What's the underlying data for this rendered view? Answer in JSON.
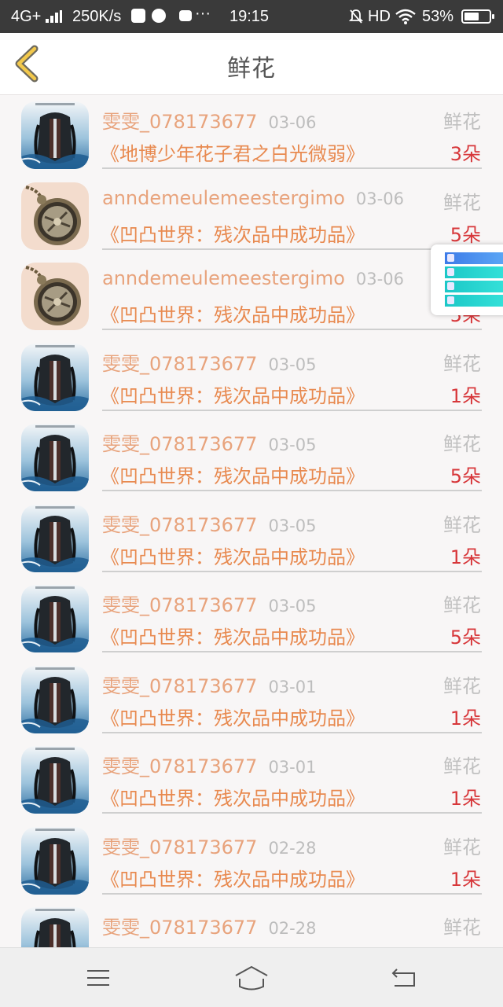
{
  "status_bar": {
    "network": "4G+",
    "speed": "250K/s",
    "time": "19:15",
    "hd": "HD",
    "battery": "53%",
    "battery_level": 0.53
  },
  "header": {
    "title": "鲜花",
    "back_icon": "chevron-left-icon"
  },
  "list": {
    "items": [
      {
        "user": "雯雯_078173677",
        "date": "03-06",
        "type": "鲜花",
        "book": "《地博少年花子君之白光微弱》",
        "count": "3朵",
        "avatar": "backpack"
      },
      {
        "user": "anndemeulemeestergimo",
        "date": "03-06",
        "type": "鲜花",
        "book": "《凹凸世界：残次品中成功品》",
        "count": "5朵",
        "avatar": "pocket-watch"
      },
      {
        "user": "anndemeulemeestergimo",
        "date": "03-06",
        "type": "鲜花",
        "book": "《凹凸世界：残次品中成功品》",
        "count": "5朵",
        "avatar": "pocket-watch"
      },
      {
        "user": "雯雯_078173677",
        "date": "03-05",
        "type": "鲜花",
        "book": "《凹凸世界：残次品中成功品》",
        "count": "1朵",
        "avatar": "backpack"
      },
      {
        "user": "雯雯_078173677",
        "date": "03-05",
        "type": "鲜花",
        "book": "《凹凸世界：残次品中成功品》",
        "count": "5朵",
        "avatar": "backpack"
      },
      {
        "user": "雯雯_078173677",
        "date": "03-05",
        "type": "鲜花",
        "book": "《凹凸世界：残次品中成功品》",
        "count": "1朵",
        "avatar": "backpack"
      },
      {
        "user": "雯雯_078173677",
        "date": "03-05",
        "type": "鲜花",
        "book": "《凹凸世界：残次品中成功品》",
        "count": "5朵",
        "avatar": "backpack"
      },
      {
        "user": "雯雯_078173677",
        "date": "03-01",
        "type": "鲜花",
        "book": "《凹凸世界：残次品中成功品》",
        "count": "1朵",
        "avatar": "backpack"
      },
      {
        "user": "雯雯_078173677",
        "date": "03-01",
        "type": "鲜花",
        "book": "《凹凸世界：残次品中成功品》",
        "count": "1朵",
        "avatar": "backpack"
      },
      {
        "user": "雯雯_078173677",
        "date": "02-28",
        "type": "鲜花",
        "book": "《凹凸世界：残次品中成功品》",
        "count": "1朵",
        "avatar": "backpack"
      },
      {
        "user": "雯雯_078173677",
        "date": "02-28",
        "type": "鲜花",
        "book": "",
        "count": "",
        "avatar": "backpack"
      }
    ]
  },
  "navbar": {
    "menu_icon": "menu-icon",
    "home_icon": "home-icon",
    "back_icon": "back-arrow-icon"
  },
  "colors": {
    "username": "#e8a37c",
    "book_title": "#e88a50",
    "count": "#d7373a",
    "date": "#bdbdbd",
    "status_bar_bg": "#3a3a3a"
  }
}
